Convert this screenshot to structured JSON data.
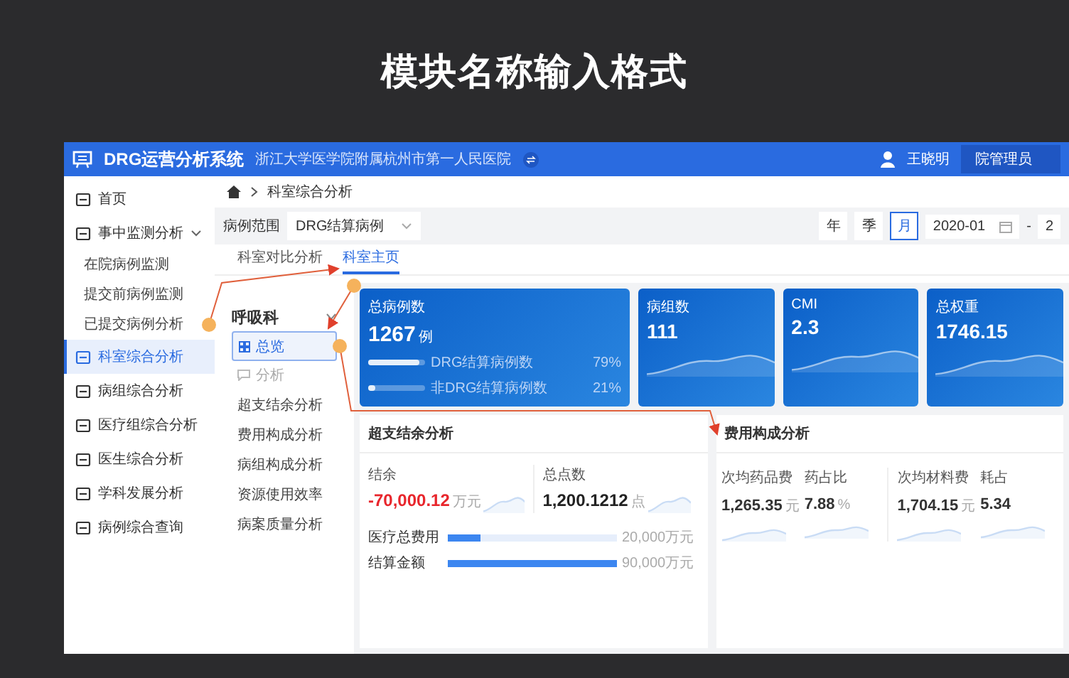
{
  "slide_title": "模块名称输入格式",
  "header": {
    "app_name": "DRG运营分析系统",
    "hospital": "浙江大学医学院附属杭州市第一人民医院",
    "user": "王晓明",
    "role": "院管理员"
  },
  "sidebar": {
    "items": [
      {
        "kind": "item",
        "label": "首页",
        "selected": false
      },
      {
        "kind": "group",
        "label": "事中监测分析",
        "selected": false,
        "expanded": true,
        "children": [
          {
            "label": "在院病例监测",
            "selected": false
          },
          {
            "label": "提交前病例监测",
            "selected": false
          },
          {
            "label": "已提交病例分析",
            "selected": false
          }
        ]
      },
      {
        "kind": "item",
        "label": "科室综合分析",
        "selected": true
      },
      {
        "kind": "item",
        "label": "病组综合分析",
        "selected": false
      },
      {
        "kind": "item",
        "label": "医疗组综合分析",
        "selected": false
      },
      {
        "kind": "item",
        "label": "医生综合分析",
        "selected": false
      },
      {
        "kind": "item",
        "label": "学科发展分析",
        "selected": false
      },
      {
        "kind": "item",
        "label": "病例综合查询",
        "selected": false
      }
    ]
  },
  "breadcrumb": [
    "科室综合分析"
  ],
  "filter": {
    "label": "病例范围",
    "value": "DRG结算病例"
  },
  "period": [
    {
      "label": "年",
      "selected": false
    },
    {
      "label": "季",
      "selected": false
    },
    {
      "label": "月",
      "selected": true
    }
  ],
  "date_range": {
    "start": "2020-01",
    "separator": "-",
    "end": "2"
  },
  "tabs": [
    {
      "label": "科室对比分析",
      "selected": false
    },
    {
      "label": "科室主页",
      "selected": true
    }
  ],
  "department": {
    "name": "呼吸科",
    "nav": [
      {
        "kind": "item",
        "label": "总览",
        "selected": true
      },
      {
        "kind": "section",
        "label": "分析"
      },
      {
        "kind": "item",
        "label": "超支结余分析",
        "selected": false
      },
      {
        "kind": "item",
        "label": "费用构成分析",
        "selected": false
      },
      {
        "kind": "item",
        "label": "病组构成分析",
        "selected": false
      },
      {
        "kind": "item",
        "label": "资源使用效率",
        "selected": false
      },
      {
        "kind": "item",
        "label": "病案质量分析",
        "selected": false
      }
    ]
  },
  "summary": {
    "label": "总病例数",
    "value": "1267",
    "unit": "例",
    "bars": [
      {
        "label": "DRG结算病例数",
        "reading": "79%",
        "level": 0.9
      },
      {
        "label": "非DRG结算病例数",
        "reading": "21%",
        "level": 0.12
      }
    ]
  },
  "stat_cards": [
    {
      "label": "病组数",
      "value": "111"
    },
    {
      "label": "CMI",
      "value": "2.3"
    },
    {
      "label": "总权重",
      "value": "1746.15"
    }
  ],
  "balance": {
    "title": "超支结余分析",
    "metrics": [
      {
        "label": "结余",
        "value": "-70,000.12",
        "unit": "万元",
        "negative": true
      },
      {
        "label": "总点数",
        "value": "1,200.1212",
        "unit": "点",
        "negative": false
      }
    ],
    "bars": [
      {
        "label": "医疗总费用",
        "level": 0.19,
        "reading": "20,000万元"
      },
      {
        "label": "结算金额",
        "level": 1,
        "reading": "90,000万元"
      }
    ]
  },
  "cost": {
    "title": "费用构成分析",
    "metrics": [
      {
        "label": "次均药品费",
        "value": "1,265.35",
        "unit": "元"
      },
      {
        "label": "药占比",
        "value": "7.88",
        "unit": "%"
      },
      {
        "label": "次均材料费",
        "value": "1,704.15",
        "unit": "元"
      },
      {
        "label": "耗占",
        "value": "5.34"
      }
    ]
  }
}
